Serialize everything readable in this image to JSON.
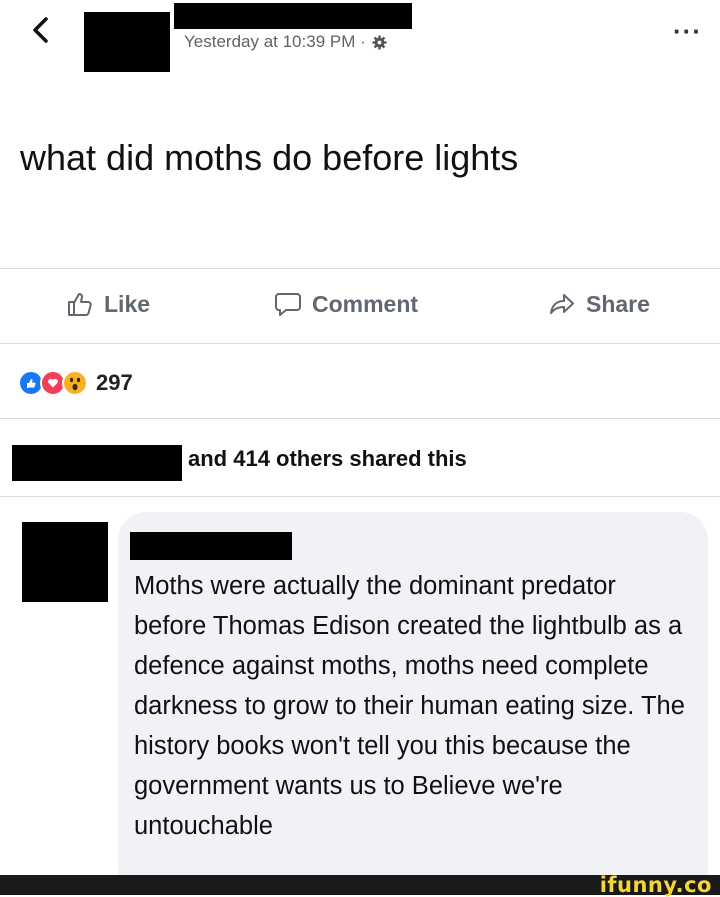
{
  "header": {
    "timestamp": "Yesterday at 10:39 PM · ",
    "more_label": "···"
  },
  "post": {
    "text": "what did moths do before lights"
  },
  "actions": {
    "like_label": "Like",
    "comment_label": "Comment",
    "share_label": "Share"
  },
  "reactions": {
    "count": "297",
    "icons": [
      "like-reaction-icon",
      "love-reaction-icon",
      "wow-reaction-icon"
    ]
  },
  "shares": {
    "text": "and 414 others shared this"
  },
  "comment": {
    "text": "Moths were actually the dominant predator before Thomas Edison created the lightbulb as a defence against moths, moths need complete darkness to grow to their human eating size. The history books won't tell you this because the government wants us to Believe we're untouchable"
  },
  "watermark": {
    "text": "ifunny.co"
  },
  "colors": {
    "like_blue": "#1877f2",
    "love_red": "#f33e58",
    "wow_yellow": "#f7b125",
    "watermark_yellow": "#f6d53a",
    "comment_bg": "#f0f2f5"
  }
}
